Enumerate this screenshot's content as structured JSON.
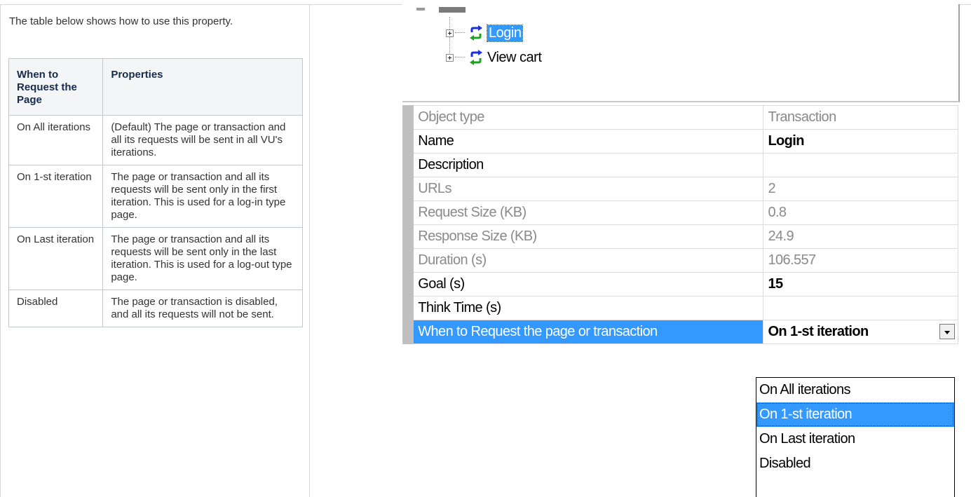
{
  "doc": {
    "intro": "The table below shows how to use this property.",
    "headers": [
      "When to Request the Page",
      "Properties"
    ],
    "rows": [
      {
        "when": "On All iterations",
        "props": "(Default) The page or transaction and all its requests will be sent in all VU's iterations."
      },
      {
        "when": "On 1-st iteration",
        "props": "The page or transaction and all its requests will be sent only in the first iteration. This is used for a log-in type page."
      },
      {
        "when": "On Last iteration",
        "props": "The page or transaction and all its requests will be sent only in the last iteration. This is used for a log-out type page."
      },
      {
        "when": "Disabled",
        "props": "The page or transaction is disabled, and all its requests will not be sent."
      }
    ]
  },
  "tree": {
    "items": [
      {
        "label": "Login",
        "selected": true,
        "icon": "transaction-icon"
      },
      {
        "label": "View cart",
        "selected": false,
        "icon": "transaction-icon"
      }
    ]
  },
  "props": {
    "rows": [
      {
        "key": "Object type",
        "value": "Transaction",
        "readonly": true,
        "bold": false
      },
      {
        "key": "Name",
        "value": "Login",
        "readonly": false,
        "bold": true
      },
      {
        "key": "Description",
        "value": "",
        "readonly": false,
        "bold": false
      },
      {
        "key": "URLs",
        "value": "2",
        "readonly": true,
        "bold": false
      },
      {
        "key": "Request Size (KB)",
        "value": "0.8",
        "readonly": true,
        "bold": false
      },
      {
        "key": "Response Size (KB)",
        "value": "24.9",
        "readonly": true,
        "bold": false
      },
      {
        "key": "Duration (s)",
        "value": "106.557",
        "readonly": true,
        "bold": false
      },
      {
        "key": "Goal (s)",
        "value": "15",
        "readonly": false,
        "bold": true
      },
      {
        "key": "Think Time (s)",
        "value": "",
        "readonly": false,
        "bold": false
      }
    ],
    "active": {
      "key": "When to Request the page or transaction",
      "value": "On 1-st iteration"
    }
  },
  "dropdown": {
    "options": [
      "On All iterations",
      "On 1-st iteration",
      "On Last iteration",
      "Disabled"
    ],
    "selected_index": 1
  },
  "colors": {
    "selection": "#3399ff",
    "gutter": "#c0c0c0",
    "icon_blue": "#1d2fd6",
    "icon_green": "#18a51a"
  }
}
